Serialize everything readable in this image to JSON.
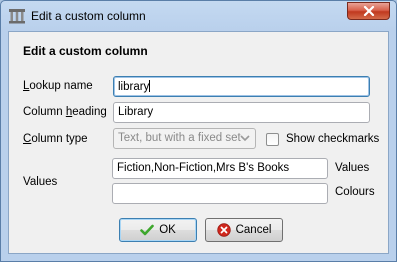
{
  "window": {
    "title": "Edit a custom column",
    "close_icon": "close-icon",
    "app_icon": "calibre-library-icon"
  },
  "form": {
    "heading": "Edit a custom column",
    "lookup_name": {
      "label_prefix": "L",
      "label_rest": "ookup name",
      "value": "library"
    },
    "column_heading": {
      "label_start": "Column ",
      "label_u": "h",
      "label_rest": "eading",
      "value": "Library"
    },
    "column_type": {
      "label_u": "C",
      "label_rest": "olumn type",
      "selected": "Text, but with a fixed set",
      "disabled": true
    },
    "show_checkmarks": {
      "label": "Show checkmarks",
      "checked": false
    },
    "values": {
      "label": "Values",
      "values_value": "Fiction,Non-Fiction,Mrs B's Books",
      "values_side_label": "Values",
      "colours_value": "",
      "colours_side_label": "Colours"
    }
  },
  "buttons": {
    "ok_label": "OK",
    "cancel_label": "Cancel"
  },
  "colors": {
    "ok_check": "#3ea72d",
    "cancel_red": "#d0271d"
  }
}
